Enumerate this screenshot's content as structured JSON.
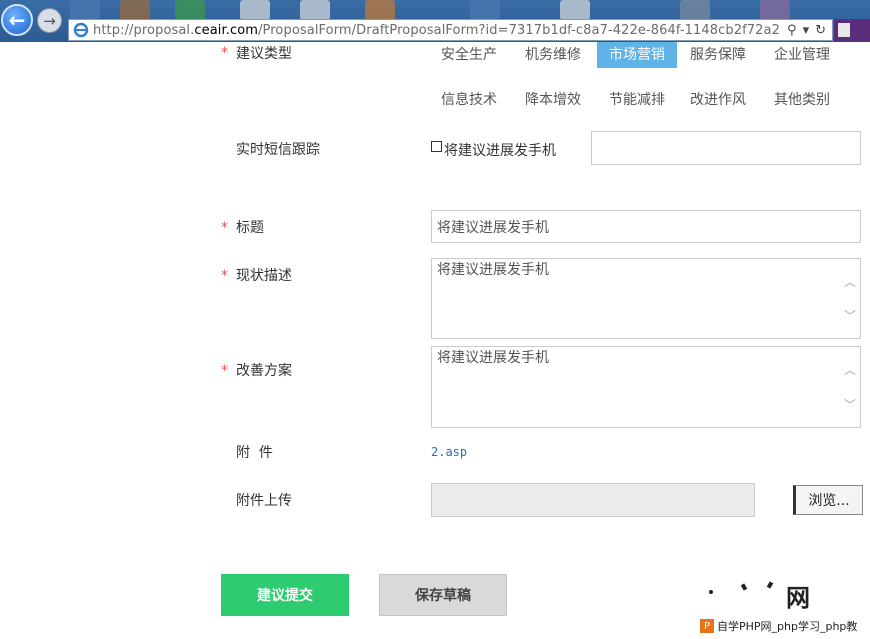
{
  "browser": {
    "url_prefix": "http://proposal.",
    "url_host": "ceair.com",
    "url_path": "/ProposalForm/DraftProposalForm?id=7317b1df-c8a7-422e-864f-1148cb2f72a2",
    "search_glyph": "⚲",
    "dropdown_glyph": "▾",
    "refresh_glyph": "↻",
    "back_glyph": "←",
    "forward_glyph": "→"
  },
  "form": {
    "type_label": "建议类型",
    "types_row1": [
      "安全生产",
      "机务维修",
      "市场营销",
      "服务保障",
      "企业管理"
    ],
    "types_row2": [
      "信息技术",
      "降本增效",
      "节能减排",
      "改进作风",
      "其他类别"
    ],
    "selected_type": "市场营销",
    "sms_label": "实时短信跟踪",
    "sms_checkbox_label": "将建议进展发手机",
    "sms_phone_value": "",
    "title_label": "标题",
    "title_value": "将建议进展发手机",
    "status_label": "现状描述",
    "status_value": "将建议进展发手机",
    "plan_label": "改善方案",
    "plan_value": "将建议进展发手机",
    "attachment_label": "附  件",
    "attachment_file": "2.asp",
    "upload_label": "附件上传",
    "upload_value": "",
    "browse_button": "浏览...",
    "submit_button": "建议提交",
    "save_draft_button": "保存草稿",
    "required_mark": "*"
  },
  "watermark": {
    "logo_text": "网",
    "caption": "自学PHP网_php学习_php教"
  },
  "colors": {
    "selected_bg": "#5fb3e6",
    "submit_bg": "#2ecc71",
    "draft_bg": "#d9d9d9",
    "required": "#e05050",
    "attachment_link": "#2a6fb5"
  }
}
